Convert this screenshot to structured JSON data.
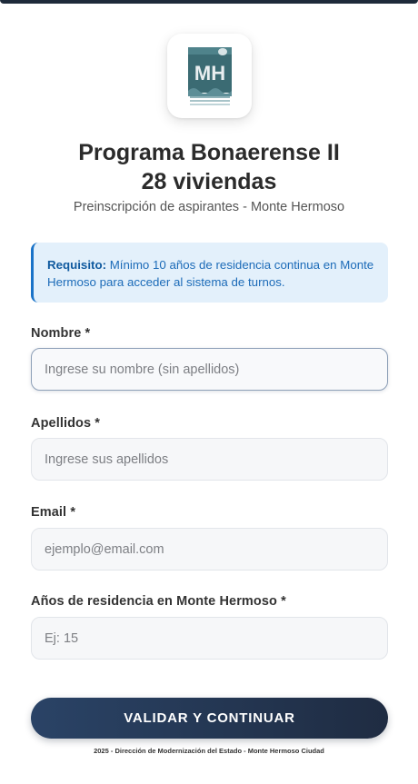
{
  "logo": {
    "text": "MH",
    "icon": "mh-logo-icon"
  },
  "header": {
    "title_line1": "Programa Bonaerense II",
    "title_line2": "28 viviendas",
    "subtitle": "Preinscripción de aspirantes - Monte Hermoso"
  },
  "notice": {
    "label": "Requisito:",
    "text": " Mínimo 10 años de residencia continua en Monte Hermoso para acceder al sistema de turnos."
  },
  "form": {
    "nombre": {
      "label": "Nombre *",
      "placeholder": "Ingrese su nombre (sin apellidos)",
      "value": ""
    },
    "apellidos": {
      "label": "Apellidos *",
      "placeholder": "Ingrese sus apellidos",
      "value": ""
    },
    "email": {
      "label": "Email *",
      "placeholder": "ejemplo@email.com",
      "value": ""
    },
    "residencia": {
      "label": "Años de residencia en Monte Hermoso *",
      "placeholder": "Ej: 15",
      "value": ""
    },
    "submit_label": "VALIDAR Y CONTINUAR"
  },
  "footer": {
    "text": "2025 - Dirección de Modernización del Estado - Monte Hermoso Ciudad"
  },
  "colors": {
    "primary": "#2a4366",
    "notice_bg": "#e3f0fb",
    "notice_accent": "#1a73c8"
  }
}
